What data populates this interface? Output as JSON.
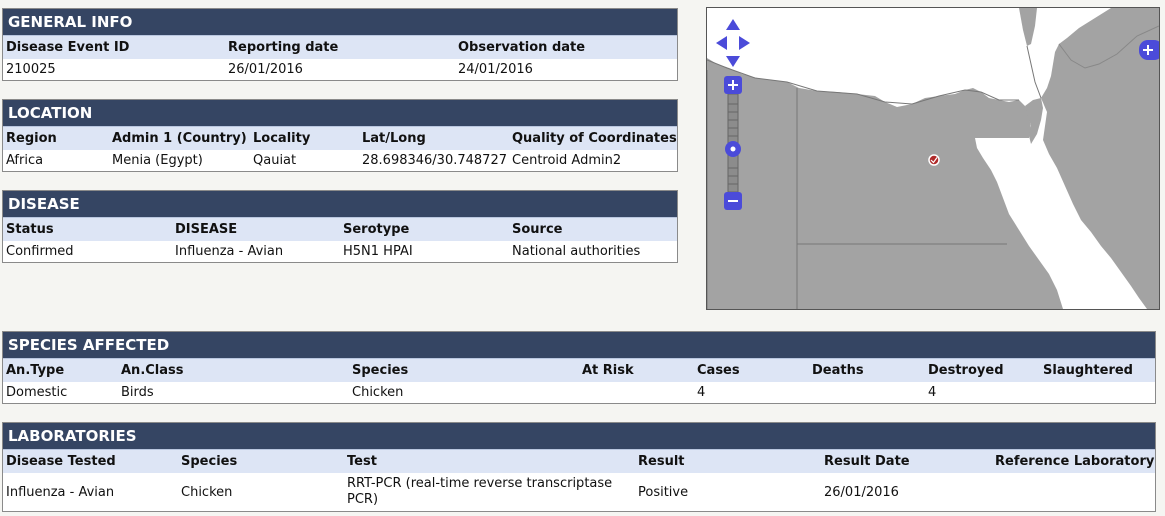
{
  "general": {
    "title": "GENERAL INFO",
    "headers": [
      "Disease Event ID",
      "Reporting date",
      "Observation date"
    ],
    "values": [
      "210025",
      "26/01/2016",
      "24/01/2016"
    ]
  },
  "location": {
    "title": "LOCATION",
    "headers": [
      "Region",
      "Admin 1 (Country)",
      "Locality",
      "Lat/Long",
      "Quality of Coordinates"
    ],
    "values": [
      "Africa",
      "Menia (Egypt)",
      "Qauiat",
      "28.698346/30.748727",
      "Centroid Admin2"
    ]
  },
  "disease": {
    "title": "DISEASE",
    "headers": [
      "Status",
      "DISEASE",
      "Serotype",
      "Source"
    ],
    "values": [
      "Confirmed",
      "Influenza - Avian",
      "H5N1 HPAI",
      "National authorities"
    ]
  },
  "species": {
    "title": "SPECIES AFFECTED",
    "headers": [
      "An.Type",
      "An.Class",
      "Species",
      "At Risk",
      "Cases",
      "Deaths",
      "Destroyed",
      "Slaughtered"
    ],
    "values": [
      "Domestic",
      "Birds",
      "Chicken",
      "",
      "4",
      "",
      "4",
      ""
    ]
  },
  "laboratories": {
    "title": "LABORATORIES",
    "headers": [
      "Disease Tested",
      "Species",
      "Test",
      "Result",
      "Result Date",
      "Reference Laboratory"
    ],
    "values": [
      "Influenza - Avian",
      "Chicken",
      "RRT-PCR (real-time reverse transcriptase PCR)",
      "Positive",
      "26/01/2016",
      ""
    ]
  },
  "map": {
    "land_color": "#a3a3a3",
    "water_color": "#ffffff",
    "control_color": "#4b4bd9",
    "marker_color": "#b02a2a",
    "icons": [
      "pan-up-icon",
      "pan-left-icon",
      "pan-right-icon",
      "pan-down-icon",
      "zoom-in-icon",
      "zoom-slider-icon",
      "zoom-out-icon",
      "layer-switcher-icon",
      "outbreak-marker-icon"
    ]
  }
}
